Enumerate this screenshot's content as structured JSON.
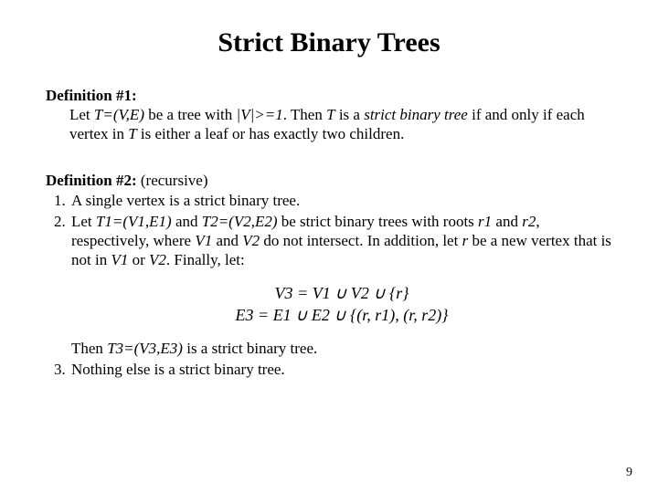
{
  "title": "Strict Binary Trees",
  "def1": {
    "heading": "Definition #1:",
    "body_pre": "Let ",
    "body_TVE": "T=(V,E)",
    "body_mid1": " be a tree with ",
    "body_V1": "|V|>=1",
    "body_mid2": ". Then ",
    "body_T": "T",
    "body_mid3": " is a ",
    "body_sbt": "strict binary tree",
    "body_mid4": " if and only if each vertex in ",
    "body_T2": "T",
    "body_end": " is either a leaf or has exactly two children."
  },
  "def2": {
    "heading": "Definition #2:",
    "recursive": " (recursive)",
    "item1": "A single vertex is a strict binary tree.",
    "item2": {
      "a": "Let ",
      "T1": "T1=(V1,E1)",
      "b": " and ",
      "T2": "T2=(V2,E2)",
      "c": " be strict binary trees with roots ",
      "r1": "r1",
      "d": " and ",
      "r2": "r2",
      "e": ", respectively, where ",
      "V1": "V1",
      "f": " and ",
      "V2": "V2",
      "g": " do not intersect. In addition, let ",
      "r": "r",
      "h": " be a new vertex that is not in ",
      "V1b": "V1",
      "i": " or ",
      "V2b": "V2",
      "j": ". Finally, let:"
    },
    "eq1": "V3 = V1 ∪ V2 ∪ {r}",
    "eq2": "E3 = E1 ∪ E2 ∪ {(r, r1), (r, r2)}",
    "after": {
      "a": "Then ",
      "T3": "T3=(V3,E3)",
      "b": " is a strict binary tree."
    },
    "item3": "Nothing else is a strict binary tree."
  },
  "pagenum": "9"
}
